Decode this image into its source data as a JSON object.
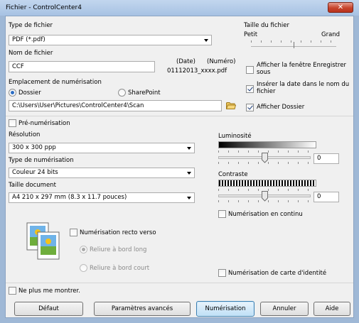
{
  "window": {
    "title": "Fichier - ControlCenter4",
    "close_glyph": "✕"
  },
  "file_type": {
    "label": "Type de fichier",
    "value": "PDF (*.pdf)"
  },
  "file_size": {
    "label": "Taille du fichier",
    "small": "Petit",
    "large": "Grand",
    "level_fraction": 0.5
  },
  "file_name": {
    "label": "Nom de fichier",
    "value": "CCF",
    "date_label": "(Date)",
    "number_label": "(Numéro)",
    "sample": "01112013_xxxx.pdf"
  },
  "save_dialog": {
    "label": "Afficher la fenêtre Enregistrer sous",
    "checked": false
  },
  "insert_date": {
    "label": "Insérer la date dans le nom du fichier",
    "checked": true
  },
  "show_folder": {
    "label": "Afficher Dossier",
    "checked": true
  },
  "location": {
    "label": "Emplacement de numérisation",
    "folder": "Dossier",
    "sharepoint": "SharePoint",
    "selected": "Dossier",
    "path": "C:\\Users\\User\\Pictures\\ControlCenter4\\Scan"
  },
  "prescan": {
    "label": "Pré-numérisation",
    "checked": false
  },
  "resolution": {
    "label": "Résolution",
    "value": "300 x 300 ppp"
  },
  "scan_type": {
    "label": "Type de numérisation",
    "value": "Couleur 24 bits"
  },
  "doc_size": {
    "label": "Taille document",
    "value": "A4 210 x 297 mm (8.3 x 11.7 pouces)"
  },
  "brightness": {
    "label": "Luminosité",
    "value": "0"
  },
  "contrast": {
    "label": "Contraste",
    "value": "0"
  },
  "continuous": {
    "label": "Numérisation en continu",
    "checked": false
  },
  "duplex": {
    "label": "Numérisation recto verso",
    "checked": false,
    "long_edge": "Reliure à bord long",
    "short_edge": "Reliure à bord court",
    "selected": "Reliure à bord long"
  },
  "id_card": {
    "label": "Numérisation de carte d'identité",
    "checked": false
  },
  "dont_show": {
    "label": "Ne plus me montrer.",
    "checked": false
  },
  "buttons": {
    "default": "Défaut",
    "advanced": "Paramètres avancés",
    "scan": "Numérisation",
    "cancel": "Annuler",
    "help": "Aide"
  },
  "colors": {
    "title_bg": "#b6cde9",
    "close_red": "#c7442c",
    "dialog_bg": "#f0f0f0",
    "default_btn_border": "#3c7fb1"
  }
}
